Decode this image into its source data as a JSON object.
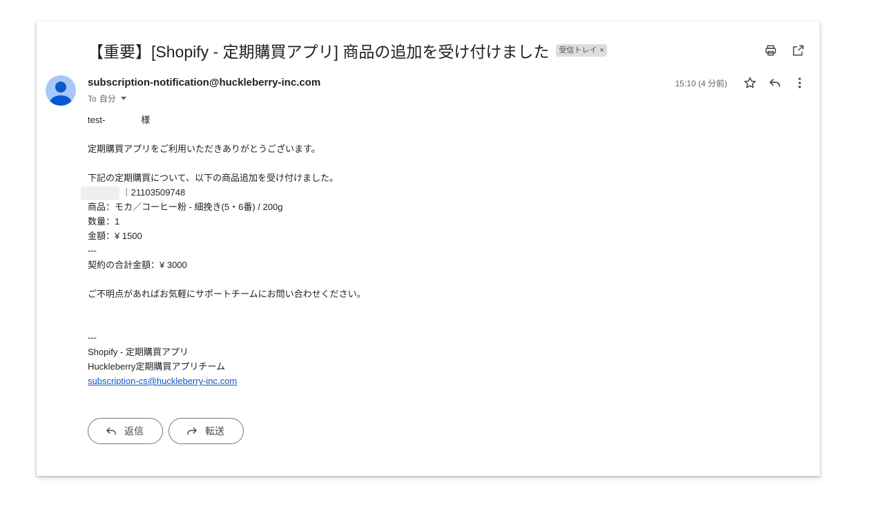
{
  "email": {
    "subject": "【重要】[Shopify - 定期購買アプリ] 商品の追加を受け付けました",
    "label": "受信トレイ",
    "label_remove": "×",
    "sender": "subscription-notification@huckleberry-inc.com",
    "to_prefix": "To",
    "to_recipient": "自分",
    "time": "15:10 (4 分前)",
    "body": {
      "greeting_name": "test-",
      "greeting_suffix": "様",
      "thanks": "定期購買アプリをご利用いただきありがとうございます。",
      "intro": "下記の定期購買について、以下の商品追加を受け付けました。",
      "contract_id": "｜21103509748",
      "product": "商品：モカ／コーヒー粉 - 細挽き(5・6番) / 200g",
      "quantity": "数量：1",
      "amount": "金額：¥ 1500",
      "separator": "---",
      "total": "契約の合計金額：¥ 3000",
      "contact": "ご不明点があればお気軽にサポートチームにお問い合わせください。",
      "sig_separator": "---",
      "sig_app": "Shopify - 定期購買アプリ",
      "sig_team": "Huckleberry定期購買アプリチーム",
      "sig_email": "subscription-cs@huckleberry-inc.com"
    }
  },
  "actions": {
    "reply_label": "返信",
    "forward_label": "転送"
  },
  "icons": {
    "print": "print-icon",
    "open_new_window": "open-in-new-icon",
    "star": "star-icon",
    "reply": "reply-icon",
    "more": "more-vert-icon",
    "forward": "forward-icon"
  },
  "colors": {
    "avatar_bg": "#a8c7fa",
    "avatar_fg": "#0b57d0",
    "link": "#1155cc"
  }
}
